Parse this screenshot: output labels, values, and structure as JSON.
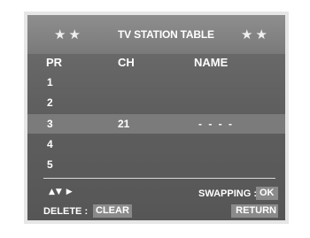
{
  "header": {
    "stars_left": "★★",
    "title": "TV STATION TABLE",
    "stars_right": "★★"
  },
  "columns": {
    "pr": "PR",
    "ch": "CH",
    "name": "NAME"
  },
  "rows": [
    {
      "pr": "1",
      "ch": "",
      "name": ""
    },
    {
      "pr": "2",
      "ch": "",
      "name": ""
    },
    {
      "pr": "3",
      "ch": "21",
      "name": "- - - -"
    },
    {
      "pr": "4",
      "ch": "",
      "name": ""
    },
    {
      "pr": "5",
      "ch": "",
      "name": ""
    }
  ],
  "selected_row": 3,
  "footer": {
    "nav_symbols": "▲▼ ▶",
    "swapping_label": "SWAPPING :",
    "swapping_key": "OK",
    "delete_label": "DELETE :",
    "delete_key": "CLEAR",
    "return_key": "RETURN"
  },
  "colors": {
    "panel": "#5f5f5f",
    "titlebar": "#7a7a7a",
    "highlight": "#7b7b7b",
    "key_background": "#8a8a8a",
    "text": "#ffffff"
  }
}
